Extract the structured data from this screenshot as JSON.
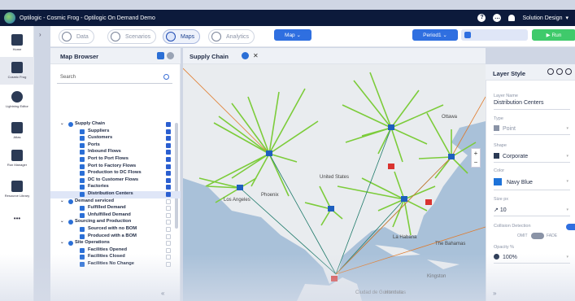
{
  "app": {
    "title": "Optilogic - Cosmic Frog - Optilogic On Demand Demo",
    "user": "Solution Design"
  },
  "rail": [
    {
      "label": "Home"
    },
    {
      "label": "Cosmic Frog"
    },
    {
      "label": "Lightning Editor"
    },
    {
      "label": "Atlas"
    },
    {
      "label": "Run Manager"
    },
    {
      "label": "Resource Library"
    },
    {
      "label": "•••"
    }
  ],
  "tabs": [
    {
      "label": "Data"
    },
    {
      "label": "Scenarios"
    },
    {
      "label": "Maps"
    },
    {
      "label": "Analytics"
    }
  ],
  "toolbar": {
    "map_label": "Map",
    "period_label": "Period1",
    "run_label": "Run"
  },
  "browser": {
    "title": "Map Browser",
    "search_placeholder": "Search",
    "tree": [
      {
        "type": "group",
        "label": "Supply Chain",
        "checked": true
      },
      {
        "type": "layer",
        "label": "Suppliers",
        "checked": true
      },
      {
        "type": "layer",
        "label": "Customers",
        "checked": true
      },
      {
        "type": "layer",
        "label": "Ports",
        "checked": true
      },
      {
        "type": "layer",
        "label": "Inbound Flows",
        "checked": true
      },
      {
        "type": "layer",
        "label": "Port to Port Flows",
        "checked": true
      },
      {
        "type": "layer",
        "label": "Port to Factory Flows",
        "checked": true
      },
      {
        "type": "layer",
        "label": "Production to DC Flows",
        "checked": true
      },
      {
        "type": "layer",
        "label": "DC to Customer Flows",
        "checked": true
      },
      {
        "type": "layer",
        "label": "Factories",
        "checked": true
      },
      {
        "type": "layer",
        "label": "Distribution Centers",
        "checked": true,
        "selected": true
      },
      {
        "type": "group",
        "label": "Demand serviced",
        "checked": false
      },
      {
        "type": "layer",
        "label": "Fulfilled Demand",
        "checked": false
      },
      {
        "type": "layer",
        "label": "Unfulfilled Demand",
        "checked": false
      },
      {
        "type": "group",
        "label": "Sourcing and Production",
        "checked": false
      },
      {
        "type": "layer",
        "label": "Sourced with no BOM",
        "checked": false
      },
      {
        "type": "layer",
        "label": "Produced with a BOM",
        "checked": false
      },
      {
        "type": "group",
        "label": "Site Operations",
        "checked": false
      },
      {
        "type": "layer",
        "label": "Facilities Opened",
        "checked": false
      },
      {
        "type": "layer",
        "label": "Facilities Closed",
        "checked": false
      },
      {
        "type": "layer",
        "label": "Facilities No Change",
        "checked": false
      }
    ]
  },
  "map": {
    "tab_label": "Supply Chain",
    "labels": [
      "Ottawa",
      "United States",
      "Los Angeles",
      "Phoenix",
      "La Habana",
      "The Bahamas",
      "Kingston",
      "Ciudad de Guatemala",
      "Honduras"
    ],
    "colors": {
      "flow_green": "#7ccc3a",
      "flow_orange": "#e07a2a",
      "flow_teal": "#1f7a6a",
      "land": "#e9ecef",
      "water": "#a9c1d9"
    }
  },
  "layer_style": {
    "title": "Layer Style",
    "layer_name_label": "Layer Name",
    "layer_name": "Distribution Centers",
    "type_label": "Type",
    "type": "Point",
    "shape_label": "Shape",
    "shape": "Corporate",
    "color_label": "Color",
    "color": "Navy Blue",
    "size_label": "Size px",
    "size": "10",
    "collision_label": "Collision Detection",
    "omit_label": "OMIT",
    "fade_label": "FADE",
    "opacity_label": "Opacity %",
    "opacity": "100%",
    "accent": "#1e73d9"
  }
}
